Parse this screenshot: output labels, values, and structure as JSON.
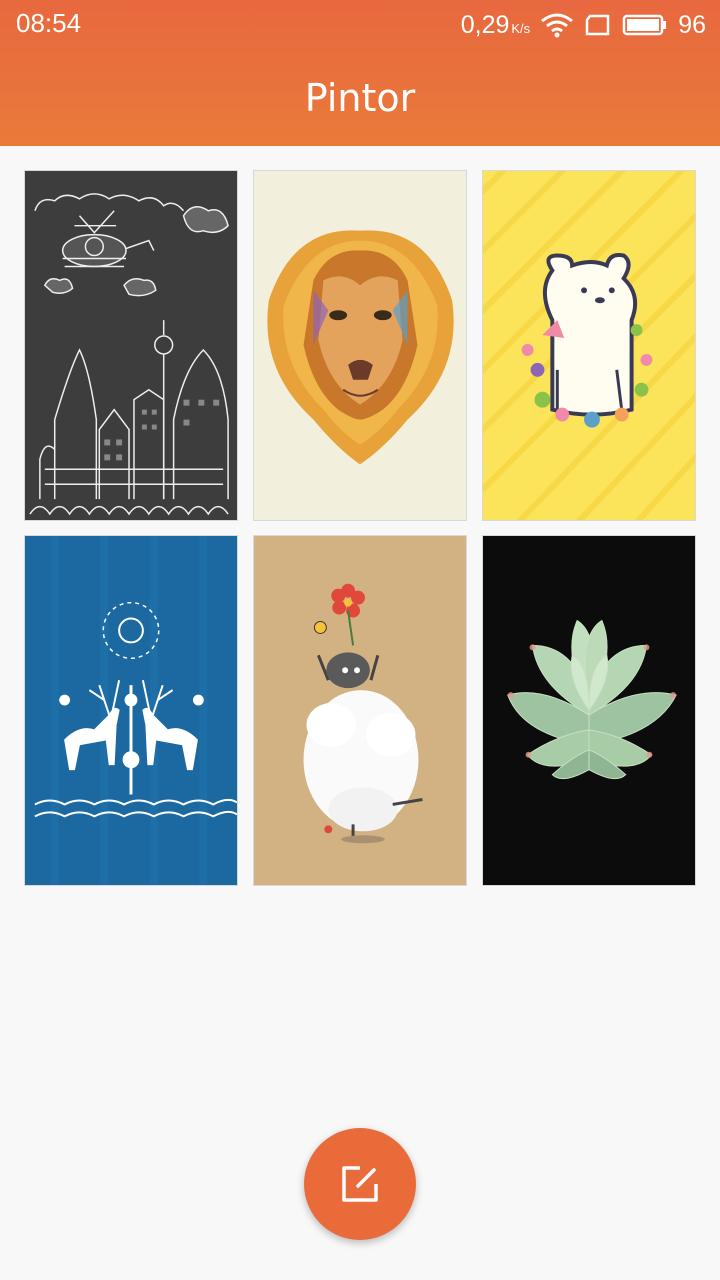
{
  "status_bar": {
    "time": "08:54",
    "network_speed": "0,29",
    "network_unit": "K/s",
    "battery_level": "96"
  },
  "app_bar": {
    "title": "Pintor"
  },
  "gallery": {
    "items": [
      {
        "name": "doodle-city-helicopter"
      },
      {
        "name": "colorful-lion"
      },
      {
        "name": "polar-bear-flowers"
      },
      {
        "name": "folk-deer-blue"
      },
      {
        "name": "sheep-flower"
      },
      {
        "name": "succulent-plant"
      }
    ]
  },
  "fab": {
    "icon": "edit-icon"
  },
  "colors": {
    "accent": "#ea6b3a",
    "background": "#f8f8f8"
  }
}
